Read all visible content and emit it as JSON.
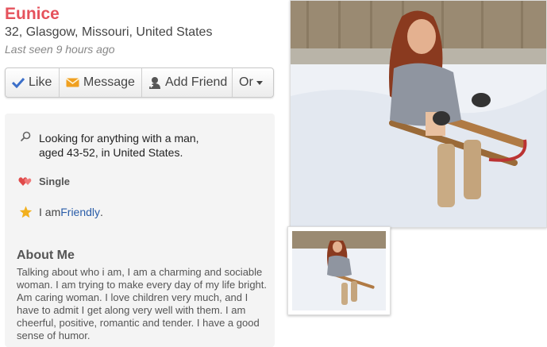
{
  "profile": {
    "name": "Eunice",
    "details": "32, Glasgow, Missouri, United States",
    "last_seen": "Last seen 9 hours ago"
  },
  "actions": {
    "like": "Like",
    "message": "Message",
    "add_friend": "Add Friend",
    "or": "Or"
  },
  "info": {
    "looking_line1": "Looking for anything with a man,",
    "looking_line2": "aged 43-52, in United States.",
    "status": "Single",
    "personality_prefix": "I am ",
    "personality_value": "Friendly",
    "personality_suffix": "."
  },
  "about": {
    "title": "About Me",
    "text": "Talking about who i am, I am a charming and sociable woman. I am trying to make every day of my life bright. Am caring woman. I love children very much, and I have to admit I get along very well with them. I am cheerful, positive, romantic and tender. I have a good sense of humor."
  },
  "colors": {
    "name": "#e5525c",
    "link": "#2a5da8",
    "like_icon": "#3b6fc9",
    "message_icon": "#f0a020",
    "heart_icon": "#e04a4a",
    "star_icon": "#f2b01e"
  },
  "icons": {
    "like": "checkmark-icon",
    "message": "envelope-icon",
    "add_friend": "add-person-icon",
    "looking": "search-icon",
    "status": "hearts-icon",
    "personality": "star-icon"
  }
}
